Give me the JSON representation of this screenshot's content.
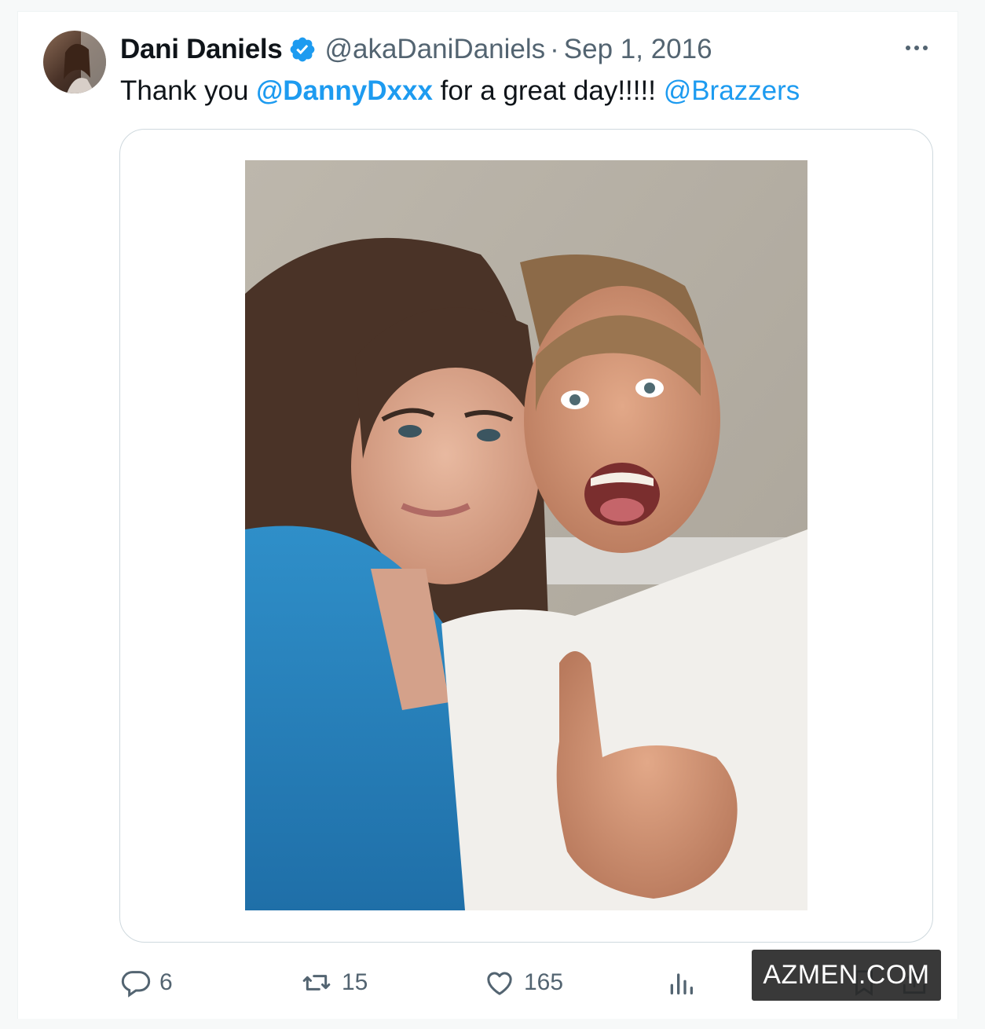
{
  "tweet": {
    "author": {
      "display_name": "Dani Daniels",
      "handle": "@akaDaniDaniels",
      "verified": true,
      "avatar_icon": "profile-photo"
    },
    "separator": "·",
    "date": "Sep 1, 2016",
    "more_icon": "ellipsis-icon",
    "text": {
      "before": "Thank you ",
      "mention1": "@DannyDxxx",
      "middle": " for a great day!!!!! ",
      "mention2": "@Brazzers"
    },
    "media": {
      "type": "photo"
    },
    "actions": {
      "reply": {
        "icon": "reply-icon",
        "count": "6"
      },
      "retweet": {
        "icon": "retweet-icon",
        "count": "15"
      },
      "like": {
        "icon": "heart-icon",
        "count": "165"
      },
      "views": {
        "icon": "views-icon"
      },
      "bookmark": {
        "icon": "bookmark-icon"
      },
      "share": {
        "icon": "share-icon"
      }
    }
  },
  "watermark": "AZMEN.COM",
  "colors": {
    "accent": "#1d9bf0",
    "text": "#0f1419",
    "secondary": "#536471",
    "border": "#cfd9de"
  }
}
